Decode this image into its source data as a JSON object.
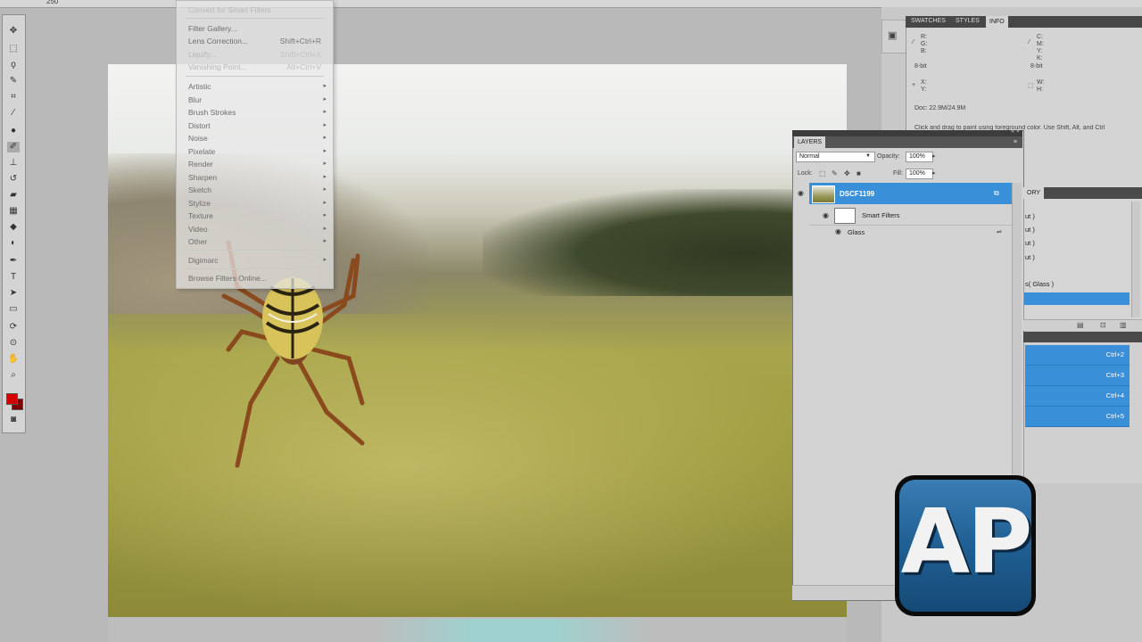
{
  "topbar": {
    "zoom": "250"
  },
  "filter_menu": {
    "items_top": [
      {
        "label": "Convert for Smart Filters",
        "shortcut": "",
        "disabled": true
      },
      {
        "label": "Filter Gallery...",
        "shortcut": "",
        "disabled": false
      },
      {
        "label": "Lens Correction...",
        "shortcut": "Shift+Ctrl+R",
        "disabled": false
      },
      {
        "label": "Liquify...",
        "shortcut": "Shift+Ctrl+X",
        "disabled": true
      },
      {
        "label": "Vanishing Point...",
        "shortcut": "Alt+Ctrl+V",
        "disabled": true
      }
    ],
    "submenus": [
      "Artistic",
      "Blur",
      "Brush Strokes",
      "Distort",
      "Noise",
      "Pixelate",
      "Render",
      "Sharpen",
      "Sketch",
      "Stylize",
      "Texture",
      "Video",
      "Other"
    ],
    "digimarc": "Digimarc",
    "browse": "Browse Filters Online..."
  },
  "info_panel": {
    "tabs": [
      "SWATCHES",
      "STYLES",
      "INFO"
    ],
    "rgb": [
      "R:",
      "G:",
      "B:"
    ],
    "cmyk": [
      "C:",
      "M:",
      "Y:",
      "K:"
    ],
    "bitdepth_left": "8-bit",
    "bitdepth_right": "8-bit",
    "xy": [
      "X:",
      "Y:"
    ],
    "wh": [
      "W:",
      "H:"
    ],
    "doc": "Doc: 22.9M/24.9M",
    "hint": "Click and drag to paint using foreground color.  Use Shift, Alt, and Ctrl"
  },
  "layers": {
    "title": "LAYERS",
    "blend_mode": "Normal",
    "opacity_label": "Opacity:",
    "opacity_value": "100%",
    "lock_label": "Lock:",
    "fill_label": "Fill:",
    "fill_value": "100%",
    "layer_name": "DSCF1199",
    "smart_filters_label": "Smart Filters",
    "filter_name": "Glass"
  },
  "history": {
    "tab": "ORY",
    "items": [
      "ut )",
      "ut )",
      "ut )",
      "ut )",
      "s( Glass )"
    ]
  },
  "actions": {
    "shortcuts": [
      "Ctrl+2",
      "Ctrl+3",
      "Ctrl+4",
      "Ctrl+5"
    ]
  },
  "logo": {
    "text": "AP"
  },
  "colors": {
    "accent": "#3a8fd9",
    "foreground": "#d40000",
    "background": "#7a0000"
  }
}
